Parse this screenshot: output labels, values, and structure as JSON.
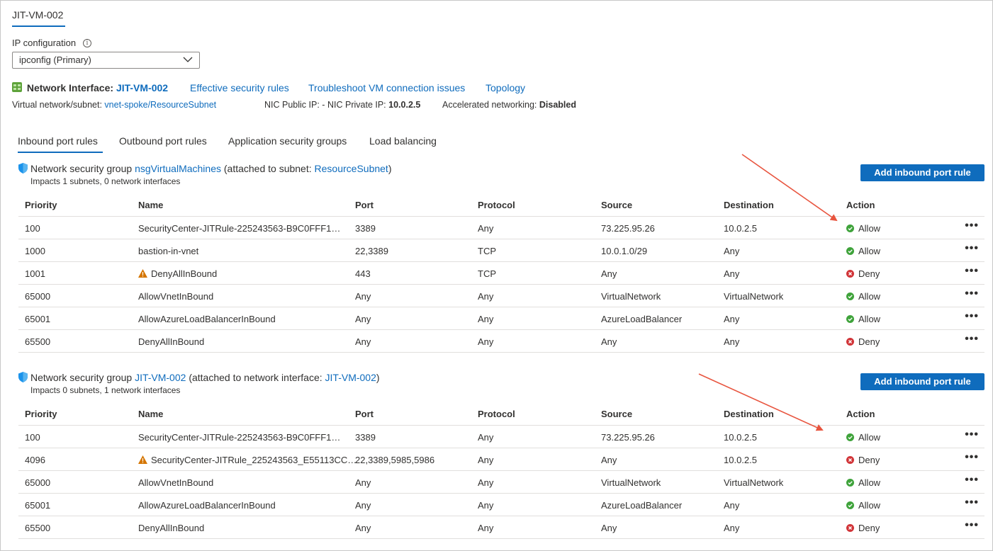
{
  "top_tab": "JIT-VM-002",
  "ip_config": {
    "label": "IP configuration",
    "info_icon": "info-icon",
    "value": "ipconfig (Primary)"
  },
  "nic": {
    "title": "Network Interface:",
    "name": "JIT-VM-002",
    "links": [
      "Effective security rules",
      "Troubleshoot VM connection issues",
      "Topology"
    ],
    "vnet_label": "Virtual network/subnet:",
    "vnet_value": "vnet-spoke/ResourceSubnet",
    "public_ip_label": "NIC Public IP:",
    "public_ip_value": "-",
    "private_ip_label": "NIC Private IP:",
    "private_ip_value": "10.0.2.5",
    "accel_label": "Accelerated networking:",
    "accel_value": "Disabled"
  },
  "tabs": [
    "Inbound port rules",
    "Outbound port rules",
    "Application security groups",
    "Load balancing"
  ],
  "columns": [
    "Priority",
    "Name",
    "Port",
    "Protocol",
    "Source",
    "Destination",
    "Action"
  ],
  "more_label": "•••",
  "nsg1": {
    "prefix": "Network security group",
    "name": "nsgVirtualMachines",
    "attached_prefix": "(attached to subnet:",
    "attached_name": "ResourceSubnet",
    "attached_suffix": ")",
    "impacts": "Impacts 1 subnets, 0 network interfaces",
    "add_button": "Add inbound port rule",
    "rows": [
      {
        "priority": "100",
        "name": "SecurityCenter-JITRule-225243563-B9C0FFF1095...",
        "warn": false,
        "port": "3389",
        "protocol": "Any",
        "source": "73.225.95.26",
        "destination": "10.0.2.5",
        "action": "Allow"
      },
      {
        "priority": "1000",
        "name": "bastion-in-vnet",
        "warn": false,
        "port": "22,3389",
        "protocol": "TCP",
        "source": "10.0.1.0/29",
        "destination": "Any",
        "action": "Allow"
      },
      {
        "priority": "1001",
        "name": "DenyAllInBound",
        "warn": true,
        "port": "443",
        "protocol": "TCP",
        "source": "Any",
        "destination": "Any",
        "action": "Deny"
      },
      {
        "priority": "65000",
        "name": "AllowVnetInBound",
        "warn": false,
        "port": "Any",
        "protocol": "Any",
        "source": "VirtualNetwork",
        "destination": "VirtualNetwork",
        "action": "Allow"
      },
      {
        "priority": "65001",
        "name": "AllowAzureLoadBalancerInBound",
        "warn": false,
        "port": "Any",
        "protocol": "Any",
        "source": "AzureLoadBalancer",
        "destination": "Any",
        "action": "Allow"
      },
      {
        "priority": "65500",
        "name": "DenyAllInBound",
        "warn": false,
        "port": "Any",
        "protocol": "Any",
        "source": "Any",
        "destination": "Any",
        "action": "Deny"
      }
    ]
  },
  "nsg2": {
    "prefix": "Network security group",
    "name": "JIT-VM-002",
    "attached_prefix": "(attached to network interface:",
    "attached_name": "JIT-VM-002",
    "attached_suffix": ")",
    "impacts": "Impacts 0 subnets, 1 network interfaces",
    "add_button": "Add inbound port rule",
    "rows": [
      {
        "priority": "100",
        "name": "SecurityCenter-JITRule-225243563-B9C0FFF1095...",
        "warn": false,
        "port": "3389",
        "protocol": "Any",
        "source": "73.225.95.26",
        "destination": "10.0.2.5",
        "action": "Allow"
      },
      {
        "priority": "4096",
        "name": "SecurityCenter-JITRule_225243563_E55113CC4...",
        "warn": true,
        "port": "22,3389,5985,5986",
        "protocol": "Any",
        "source": "Any",
        "destination": "10.0.2.5",
        "action": "Deny"
      },
      {
        "priority": "65000",
        "name": "AllowVnetInBound",
        "warn": false,
        "port": "Any",
        "protocol": "Any",
        "source": "VirtualNetwork",
        "destination": "VirtualNetwork",
        "action": "Allow"
      },
      {
        "priority": "65001",
        "name": "AllowAzureLoadBalancerInBound",
        "warn": false,
        "port": "Any",
        "protocol": "Any",
        "source": "AzureLoadBalancer",
        "destination": "Any",
        "action": "Allow"
      },
      {
        "priority": "65500",
        "name": "DenyAllInBound",
        "warn": false,
        "port": "Any",
        "protocol": "Any",
        "source": "Any",
        "destination": "Any",
        "action": "Deny"
      }
    ]
  },
  "colors": {
    "accent": "#0f6cbd",
    "allow": "#3fa33b",
    "deny": "#d13438",
    "warning": "#d47500",
    "annotation_arrow": "#e8553f"
  }
}
